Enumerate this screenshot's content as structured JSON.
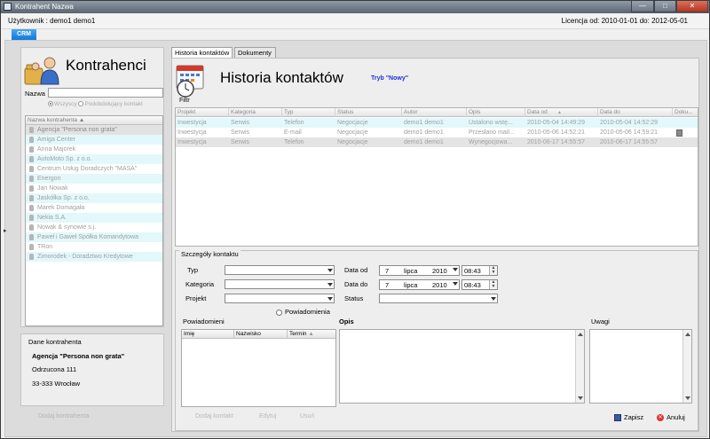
{
  "window": {
    "title": "Kontrahent Nazwa"
  },
  "userbar": {
    "user": "Użytkownik : demo1 demo1",
    "license": "Licencja od: 2010-01-01 do: 2012-05-01"
  },
  "crm_tab": "CRM",
  "left": {
    "title": "Kontrahenci",
    "name_label": "Nazwa",
    "name_value": "",
    "radio_all": "Wszyscy",
    "radio_recent": "Podobdołujący kontakt",
    "list_header": "Nazwa kontrahenta",
    "contractors": [
      "Agencja \"Persona non grata\"",
      "Amiga Center",
      "Anna Majorek",
      "AutoMoto Sp. z o.o.",
      "Centrum Usług Doradczych \"MASA\"",
      "Energon",
      "Jan Nowak",
      "Jaskółka Sp. z o.o.",
      "Marek Domagała",
      "Nekia S.A.",
      "Nowak & synowie s.j.",
      "Paweł i Gaweł Spółka Komandytowa",
      "TRon",
      "Zimorodek - Doradztwo Kredytowe"
    ],
    "details_legend": "Dane kontrahenta",
    "details_name": "Agencja \"Persona non grata\"",
    "details_street": "Odrzucona 111",
    "details_city": "33-333 Wrocław",
    "add_button": "Dodaj kontrahenta"
  },
  "tabs": {
    "history": "Historia kontaktów",
    "documents": "Dokumenty"
  },
  "right": {
    "title": "Historia kontaktów",
    "mode": "Tryb \"Nowy\"",
    "filter_label": "Filtr",
    "grid_headers": [
      "Projekt",
      "Kategoria",
      "Typ",
      "Status",
      "Autor",
      "Opis",
      "Data od",
      "Data do",
      "Doku..."
    ],
    "grid_rows": [
      [
        "Inwestycja",
        "Serwis",
        "Telefon",
        "Negocjacje",
        "demo1 demo1",
        "Ustalono wstę...",
        "2010-05-04 14:49:29",
        "2010-05-04 14:52:29",
        ""
      ],
      [
        "Inwestycja",
        "Serwis",
        "E-mail",
        "Negocjacje",
        "demo1 demo1",
        "Przesłano mail...",
        "2010-05-06 14:52:21",
        "2010-05-06 14:59:21",
        "doc"
      ],
      [
        "Inwestycja",
        "Serwis",
        "Telefon",
        "Negocjacje",
        "demo1 demo1",
        "Wynegocjowa...",
        "2010-06-17 14:55:57",
        "2010-06-17 14:55:57",
        ""
      ]
    ],
    "details_legend": "Szczegóły kontaktu",
    "typ_label": "Typ",
    "kategoria_label": "Kategoria",
    "projekt_label": "Projekt",
    "data_od_label": "Data od",
    "data_do_label": "Data do",
    "status_label": "Status",
    "date_od": {
      "day": "7",
      "month": "lipca",
      "year": "2010",
      "time": "08:43"
    },
    "date_do": {
      "day": "7",
      "month": "lipca",
      "year": "2010",
      "time": "08:43"
    },
    "powiadomienia_button": "Powiadomienia",
    "powiadomieni_label": "Powiadomieni",
    "pow_headers": [
      "Imię",
      "Nazwisko",
      "Termin"
    ],
    "opis_label": "Opis",
    "uwagi_label": "Uwagi",
    "btn_add_contact": "Dodaj kontakt",
    "btn_edit": "Edytuj",
    "btn_delete": "Usuń",
    "btn_save": "Zapisz",
    "btn_cancel": "Anuluj"
  }
}
